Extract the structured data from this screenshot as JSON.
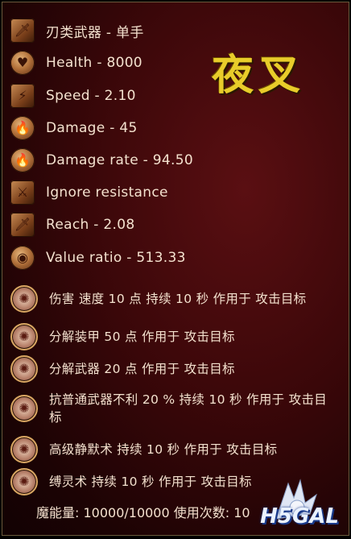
{
  "title": "夜叉",
  "stats": [
    {
      "icon": "sword-icon",
      "glyph": "🗡",
      "label": "刃类武器 - 单手"
    },
    {
      "icon": "heart-icon",
      "glyph": "♥",
      "label": "Health - 8000"
    },
    {
      "icon": "lightning-icon",
      "glyph": "⚡",
      "label": "Speed - 2.10"
    },
    {
      "icon": "flame-icon",
      "glyph": "🔥",
      "label": "Damage - 45"
    },
    {
      "icon": "flame-rate-icon",
      "glyph": "🔥",
      "label": "Damage rate - 94.50"
    },
    {
      "icon": "crossed-weapons-icon",
      "glyph": "⚔",
      "label": "Ignore resistance"
    },
    {
      "icon": "reach-sword-icon",
      "glyph": "🗡",
      "label": "Reach - 2.08"
    },
    {
      "icon": "value-icon",
      "glyph": "◉",
      "label": "Value ratio - 513.33"
    }
  ],
  "effects": [
    {
      "icon": "rune-icon",
      "label": "伤害 速度 10 点 持续 10 秒 作用于 攻击目标"
    },
    {
      "icon": "rune-icon",
      "label": "分解装甲 50 点 作用于 攻击目标"
    },
    {
      "icon": "rune-icon",
      "label": "分解武器 20 点 作用于 攻击目标"
    },
    {
      "icon": "rune-icon",
      "label": "抗普通武器不利 20 % 持续 10 秒 作用于 攻击目标"
    },
    {
      "icon": "rune-icon",
      "label": "高级静默术 持续 10 秒 作用于 攻击目标"
    },
    {
      "icon": "rune-icon",
      "label": "缚灵术 持续 10 秒 作用于 攻击目标"
    }
  ],
  "footer": {
    "mana": "魔能量: 10000/10000  使用次数: 10"
  },
  "watermark": {
    "text": "H5GAL"
  }
}
